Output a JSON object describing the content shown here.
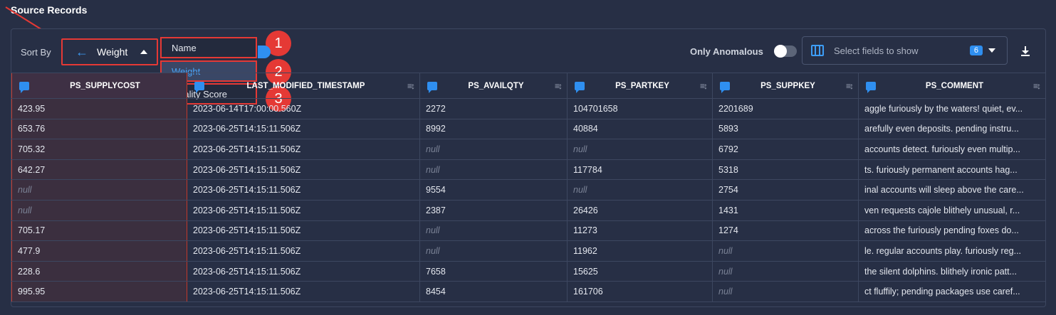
{
  "section_title": "Source Records",
  "toolbar": {
    "sort_by_label": "Sort By",
    "sort_value": "Weight",
    "sort_options": [
      "Name",
      "Weight",
      "Quality Score"
    ],
    "selected_option": "Weight",
    "only_anomalous_label": "Only Anomalous",
    "fields_placeholder": "Select fields to show",
    "fields_count": "6"
  },
  "callouts": [
    "1",
    "2",
    "3"
  ],
  "table": {
    "columns": [
      "PS_SUPPLYCOST",
      "LAST_MODIFIED_TIMESTAMP",
      "PS_AVAILQTY",
      "PS_PARTKEY",
      "PS_SUPPKEY",
      "PS_COMMENT"
    ],
    "rows": [
      [
        "423.95",
        "2023-06-14T17:00:00.560Z",
        "2272",
        "104701658",
        "2201689",
        "aggle furiously by the waters! quiet, ev..."
      ],
      [
        "653.76",
        "2023-06-25T14:15:11.506Z",
        "8992",
        "40884",
        "5893",
        "arefully even deposits. pending instru..."
      ],
      [
        "705.32",
        "2023-06-25T14:15:11.506Z",
        "null",
        "null",
        "6792",
        "accounts detect. furiously even multip..."
      ],
      [
        "642.27",
        "2023-06-25T14:15:11.506Z",
        "null",
        "117784",
        "5318",
        "ts. furiously permanent accounts hag..."
      ],
      [
        "null",
        "2023-06-25T14:15:11.506Z",
        "9554",
        "null",
        "2754",
        "inal accounts will sleep above the care..."
      ],
      [
        "null",
        "2023-06-25T14:15:11.506Z",
        "2387",
        "26426",
        "1431",
        "ven requests cajole blithely unusual, r..."
      ],
      [
        "705.17",
        "2023-06-25T14:15:11.506Z",
        "null",
        "11273",
        "1274",
        "across the furiously pending foxes do..."
      ],
      [
        "477.9",
        "2023-06-25T14:15:11.506Z",
        "null",
        "11962",
        "null",
        "le. regular accounts play. furiously reg..."
      ],
      [
        "228.6",
        "2023-06-25T14:15:11.506Z",
        "7658",
        "15625",
        "null",
        "the silent dolphins. blithely ironic patt..."
      ],
      [
        "995.95",
        "2023-06-25T14:15:11.506Z",
        "8454",
        "161706",
        "null",
        "ct fluffily; pending packages use caref..."
      ]
    ]
  },
  "colors": {
    "accent": "#2f8ff0",
    "annotation": "#e53935",
    "background": "#272f45"
  },
  "icons": [
    "arrow-left-icon",
    "caret-up-icon",
    "columns-icon",
    "caret-down-icon",
    "download-icon",
    "comment-icon",
    "sort-icon"
  ]
}
